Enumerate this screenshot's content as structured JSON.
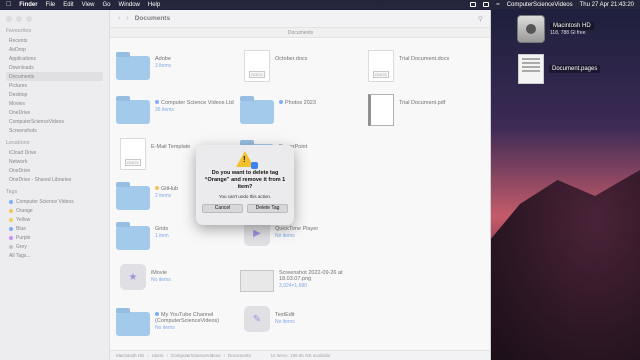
{
  "menubar": {
    "apple": "",
    "app": "Finder",
    "items": [
      "File",
      "Edit",
      "View",
      "Go",
      "Window",
      "Help"
    ],
    "right_title": "ComputerScienceVideos",
    "datetime": "Thu 27 Apr  21:43:20"
  },
  "desktop": {
    "items": [
      {
        "name": "Macintosh HD",
        "sub": "118, 788 Gl free"
      },
      {
        "name": "Document.pages",
        "sub": ""
      }
    ]
  },
  "finder": {
    "title": "Documents",
    "tab": "Documents",
    "sidebar": {
      "sections": [
        {
          "header": "Favourites",
          "items": [
            "Recents",
            "AirDrop",
            "Applications",
            "Downloads",
            "Documents",
            "Pictures",
            "Desktop",
            "Movies",
            "OneDrive",
            "ComputerScienceVideos",
            "Screenshots"
          ]
        },
        {
          "header": "Locations",
          "items": [
            "iCloud Drive",
            "Network",
            "OneDrive",
            "OneDrive - Shared Libraries"
          ]
        },
        {
          "header": "Tags",
          "items": [
            "Computer Science Videos",
            "Orange",
            "Yellow",
            "Blue",
            "Purple",
            "Grey",
            "All Tags..."
          ]
        }
      ],
      "active_index": 4
    },
    "files": [
      {
        "name": "Adobe",
        "sub": "3 items",
        "kind": "folder"
      },
      {
        "name": "October.docx",
        "sub": "",
        "kind": "doc",
        "tag": "DOCX"
      },
      {
        "name": "Trial Document.docs",
        "sub": "",
        "kind": "doc",
        "tag": "DOCS"
      },
      {
        "name": "Computer Science Videos Ltd",
        "sub": "36 items",
        "kind": "folder",
        "tagcolor": "#3b82f6"
      },
      {
        "name": "Photos 2023",
        "sub": "",
        "kind": "folder",
        "tagcolor": "#3b82f6"
      },
      {
        "name": "Trial Document.pdf",
        "sub": "",
        "kind": "pdf"
      },
      {
        "name": "E-Mail Template",
        "sub": "",
        "kind": "doc",
        "tag": "DOCX"
      },
      {
        "name": "PowerPoint",
        "sub": "",
        "kind": "folder"
      },
      {
        "name": "GitHub",
        "sub": "2 items",
        "kind": "folder",
        "tagcolor": "#f59e0b"
      },
      {
        "name": "Grids",
        "sub": "1 item",
        "kind": "folder"
      },
      {
        "name": "QuickTime Player",
        "sub": "No items",
        "kind": "app"
      },
      {
        "name": "iMovie",
        "sub": "No items",
        "kind": "app"
      },
      {
        "name": "Screenshot 2022-09-26 at 18.03.07.png",
        "sub": "3,924×1,680",
        "kind": "image"
      },
      {
        "name": "My YouTube Channel (ComputerScienceVideos)",
        "sub": "No items",
        "kind": "folder",
        "tagcolor": "#3b82f6"
      },
      {
        "name": "TextEdit",
        "sub": "No items",
        "kind": "app"
      }
    ],
    "pathbar": [
      "Macintosh HD",
      "Users",
      "ComputerScienceVideos",
      "Documents"
    ],
    "status": "15 items, 188.86 GB available"
  },
  "dialog": {
    "title": "Do you want to delete tag “Orange” and remove it from 1 item?",
    "message": "You can't undo this action.",
    "cancel": "Cancel",
    "confirm": "Delete Tag"
  },
  "colors": {
    "folder": "#74aee0",
    "tag_blue": "#3b82f6",
    "tag_orange": "#f59e0b",
    "warning": "#f2c12e"
  }
}
